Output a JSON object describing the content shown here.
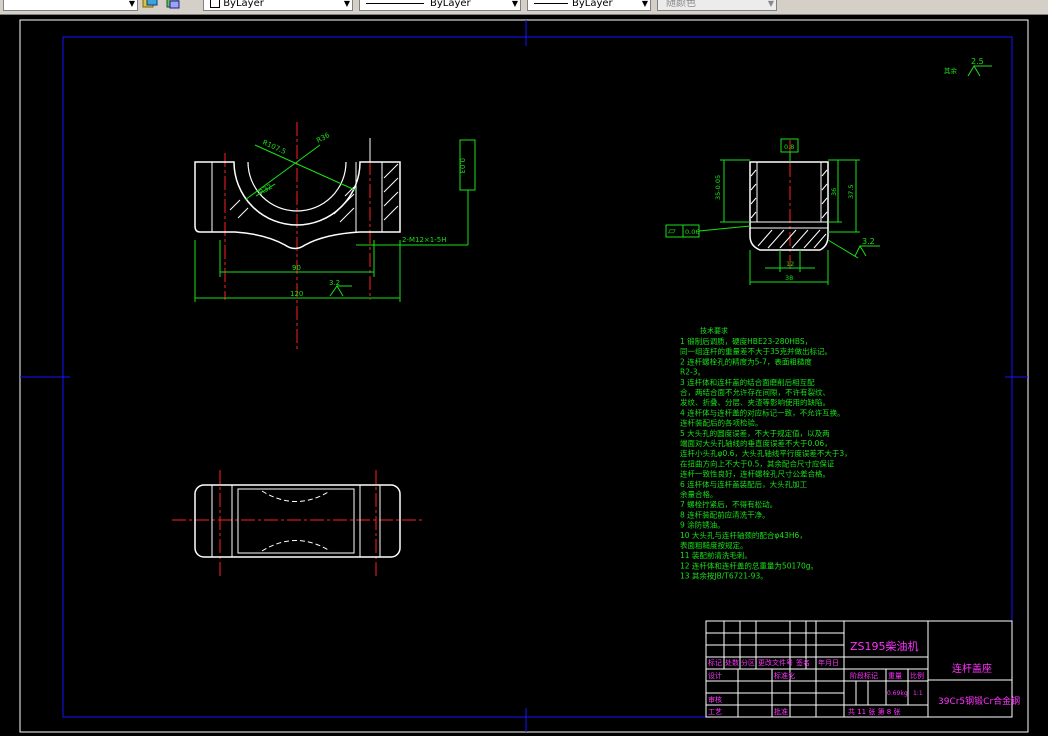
{
  "toolbar": {
    "layer_value": "ByLayer",
    "linetype_value": "ByLayer",
    "lineweight_value": "ByLayer",
    "color_value": "随颜色"
  },
  "drawing": {
    "dim_d03": "0.03",
    "dim_r107": "R107.5",
    "dim_r36": "R36",
    "dim_r32": "R32",
    "dim_2m12": "2-M12×1-5H",
    "dim_90": "90",
    "dim_120": "120",
    "rough_32_left": "3.2",
    "rough_32_right": "3.2",
    "rough_25": "2.5",
    "rough_other": "其余",
    "dim_d08": "0.8",
    "dim_35": "35-0.05",
    "dim_36": "36",
    "dim_375": "37.5",
    "dim_d06": "0.06",
    "dim_12": "12",
    "dim_38": "38"
  },
  "notes": {
    "title": "技术要求",
    "lines": [
      "1   锻制后调质，硬度HBE23-280HBS，",
      "同一组连杆的重量差不大于35克并做出标记。",
      "2   连杆螺栓孔的精度为5-7，表面粗糙度",
      "R2-3。",
      "3   连杆体和连杆盖的结合面磨削后相互配",
      "合，两结合面不允许存在间隙，不许有裂纹、",
      "发纹、折叠、分层、夹渣等影响使用的缺陷。",
      "4   连杆体与连杆盖的对应标记一致，不允许互换。",
      "连杆装配后的各项检验。",
      "5   大头孔的圆度误差，不大于规定值，以及两",
      "端面对大头孔轴线的垂直度误差不大于0.06，",
      "连杆小头孔φ0.6，大头孔轴线平行度误差不大于3，",
      "在扭曲方向上不大于0.5，其余配合尺寸应保证",
      "连杆一致性良好，连杆螺栓孔尺寸公差合格。",
      "6   连杆体与连杆盖装配后，大头孔加工",
      "余量合格。",
      "7   螺栓拧紧后，不得有松动。",
      "8   连杆装配前应清洗干净。",
      "9   涂防锈油。",
      "10  大头孔与连杆轴颈的配合φ43H6，",
      "表面粗糙度按规定。",
      "11  装配前清洗毛刺。",
      "12  连杆体和连杆盖的总重量为50170g。",
      "13  其余按JB/T6721-93。"
    ]
  },
  "titleblock": {
    "project": "ZS195柴油机",
    "part_name": "连杆盖座",
    "material": "39Cr5钢锻Cr合金钢",
    "h_mark": "标记",
    "h_qty": "处数",
    "h_zone": "分区",
    "h_docno": "更改文件号",
    "h_sign": "签名",
    "h_date": "年月日",
    "r_design": "设计",
    "r_std": "标准化",
    "r_check": "审核",
    "r_craft": "工艺",
    "r_approve": "批准",
    "stage_label": "阶段标记",
    "weight_label": "重量",
    "scale_label": "比例",
    "weight_value": "0.69kg",
    "scale_value": "1:1",
    "sheets": "共 11 张  第 8 张"
  }
}
